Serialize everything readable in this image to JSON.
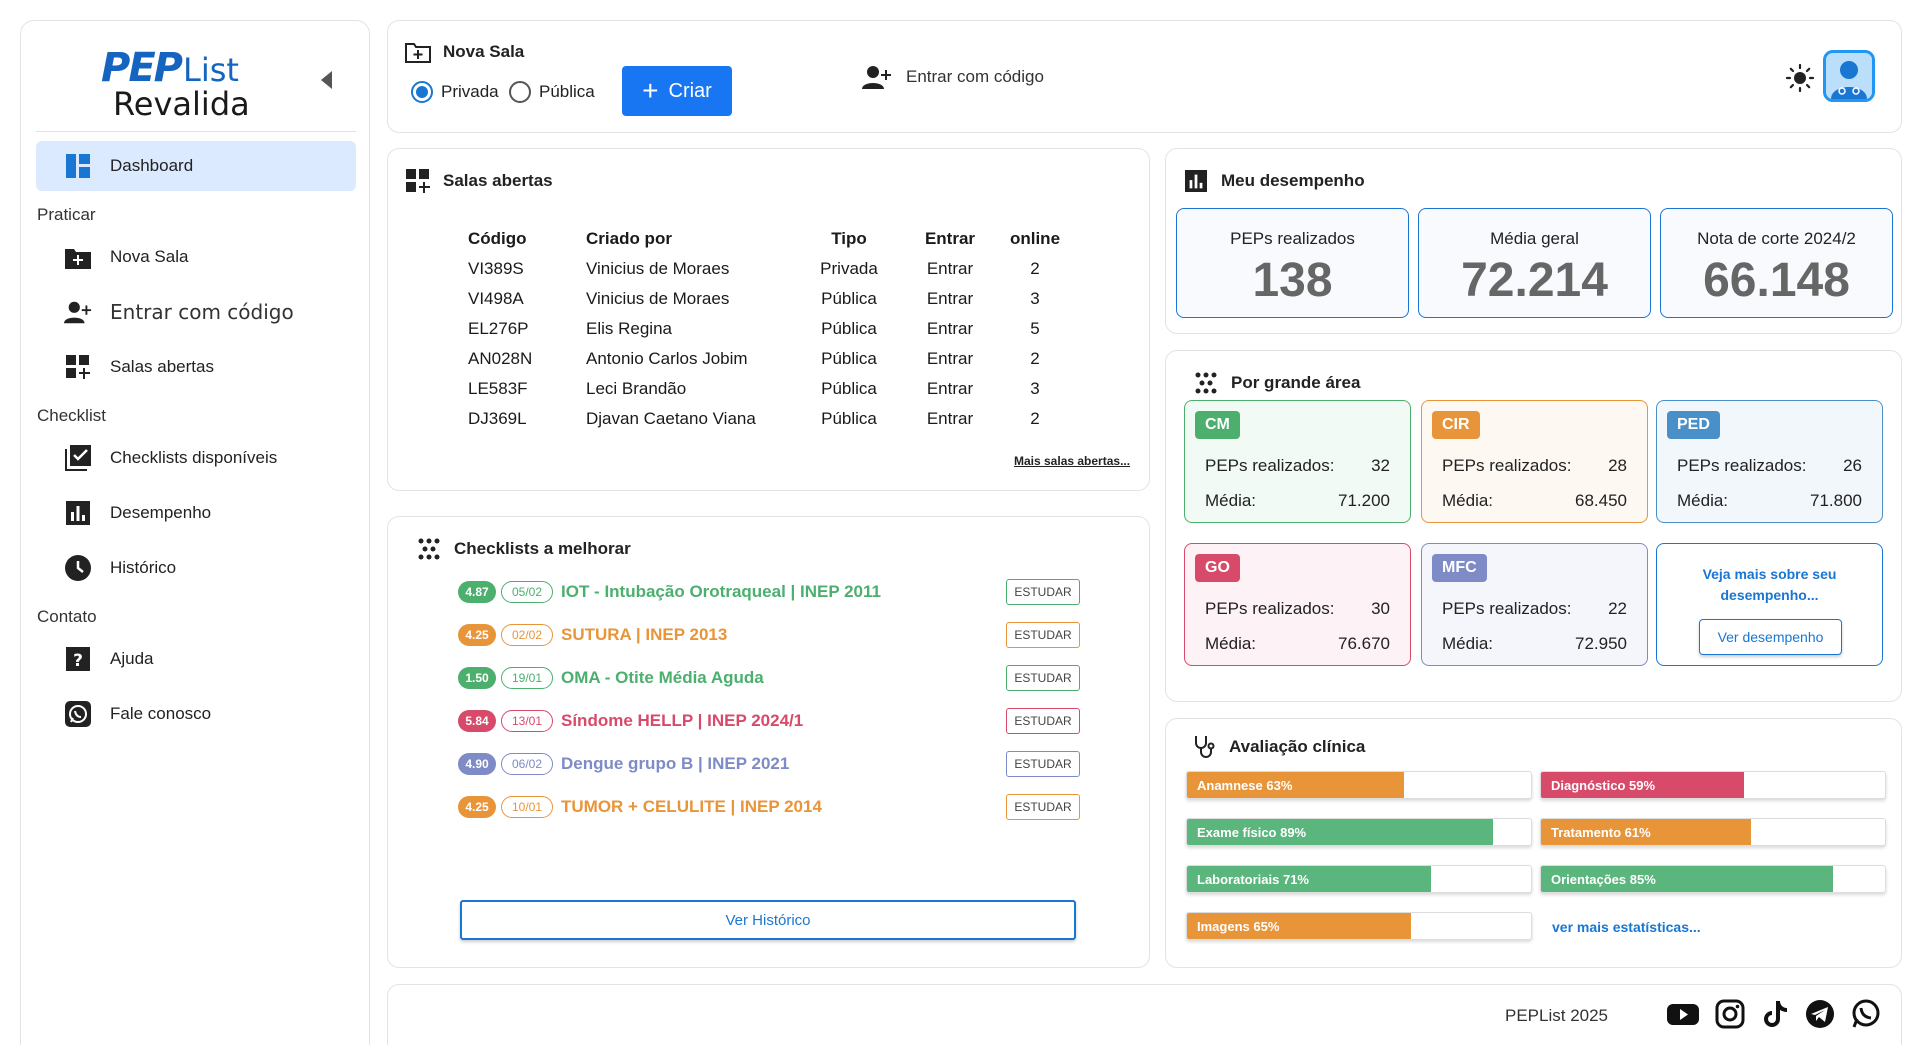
{
  "logo": {
    "brand_pep": "PEP",
    "brand_list": "List",
    "brand_sub": "Revalida"
  },
  "sidebar": {
    "dashboard": "Dashboard",
    "section_praticar": "Praticar",
    "nova_sala": "Nova Sala",
    "entrar_codigo": "Entrar com código",
    "salas_abertas": "Salas abertas",
    "section_checklist": "Checklist",
    "checklists_disponiveis": "Checklists disponíveis",
    "desempenho": "Desempenho",
    "historico": "Histórico",
    "section_contato": "Contato",
    "ajuda": "Ajuda",
    "fale_conosco": "Fale conosco"
  },
  "topbar": {
    "title": "Nova Sala",
    "privada": "Privada",
    "publica": "Pública",
    "criar": "Criar",
    "plus": "+",
    "entrar_codigo": "Entrar com código",
    "selected": "Privada"
  },
  "salas": {
    "title": "Salas abertas",
    "headers": [
      "Código",
      "Criado por",
      "Tipo",
      "Entrar",
      "online"
    ],
    "rows": [
      [
        "VI389S",
        "Vinicius de Moraes",
        "Privada",
        "Entrar",
        "2"
      ],
      [
        "VI498A",
        "Vinicius de Moraes",
        "Pública",
        "Entrar",
        "3"
      ],
      [
        "EL276P",
        "Elis Regina",
        "Pública",
        "Entrar",
        "5"
      ],
      [
        "AN028N",
        "Antonio Carlos Jobim",
        "Pública",
        "Entrar",
        "2"
      ],
      [
        "LE583F",
        "Leci Brandão",
        "Pública",
        "Entrar",
        "3"
      ],
      [
        "DJ369L",
        "Djavan Caetano Viana",
        "Pública",
        "Entrar",
        "2"
      ]
    ],
    "more": "Mais salas abertas..."
  },
  "checklists": {
    "title": "Checklists a melhorar",
    "items": [
      {
        "score": "4.87",
        "date": "05/02",
        "title": "IOT - Intubação Orotraqueal | INEP 2011",
        "color": "#4caf6e",
        "action": "ESTUDAR"
      },
      {
        "score": "4.25",
        "date": "02/02",
        "title": "SUTURA | INEP 2013",
        "color": "#e8953a",
        "action": "ESTUDAR"
      },
      {
        "score": "1.50",
        "date": "19/01",
        "title": "OMA - Otite Média Aguda",
        "color": "#4caf6e",
        "action": "ESTUDAR"
      },
      {
        "score": "5.84",
        "date": "13/01",
        "title": "Síndome HELLP | INEP 2024/1",
        "color": "#d84a6a",
        "action": "ESTUDAR"
      },
      {
        "score": "4.90",
        "date": "06/02",
        "title": "Dengue grupo B | INEP 2021",
        "color": "#7e8bc6",
        "action": "ESTUDAR"
      },
      {
        "score": "4.25",
        "date": "10/01",
        "title": "TUMOR + CELULITE | INEP 2014",
        "color": "#e8953a",
        "action": "ESTUDAR"
      }
    ],
    "ver_historico": "Ver Histórico"
  },
  "desempenho": {
    "title": "Meu desempenho",
    "stats": [
      {
        "label": "PEPs realizados",
        "value": "138"
      },
      {
        "label": "Média geral",
        "value": "72.214"
      },
      {
        "label": "Nota de corte 2024/2",
        "value": "66.148"
      }
    ]
  },
  "areas": {
    "title": "Por grande área",
    "peps_label": "PEPs realizados:",
    "media_label": "Média:",
    "items": [
      {
        "tag": "CM",
        "peps": "32",
        "media": "71.200",
        "color": "#4caf6e",
        "bg": "#f2faf5"
      },
      {
        "tag": "CIR",
        "peps": "28",
        "media": "68.450",
        "color": "#e8953a",
        "bg": "#fef8f2"
      },
      {
        "tag": "PED",
        "peps": "26",
        "media": "71.800",
        "color": "#4a90c8",
        "bg": "#f2f7fc"
      },
      {
        "tag": "GO",
        "peps": "30",
        "media": "76.670",
        "color": "#d84a6a",
        "bg": "#fdf2f5"
      },
      {
        "tag": "MFC",
        "peps": "22",
        "media": "72.950",
        "color": "#7e8bc6",
        "bg": "#f5f6fc"
      }
    ],
    "more_text": "Veja mais sobre seu desempenho...",
    "more_button": "Ver desempenho"
  },
  "avaliacao": {
    "title": "Avaliação clínica",
    "bars": [
      {
        "label": "Anamnese 63%",
        "value": 63,
        "color": "#e8953a"
      },
      {
        "label": "Diagnóstico 59%",
        "value": 59,
        "color": "#d84a6a"
      },
      {
        "label": "Exame físico 89%",
        "value": 89,
        "color": "#5bb67e"
      },
      {
        "label": "Tratamento 61%",
        "value": 61,
        "color": "#e8953a"
      },
      {
        "label": "Laboratoriais 71%",
        "value": 71,
        "color": "#5bb67e"
      },
      {
        "label": "Orientações 85%",
        "value": 85,
        "color": "#5bb67e"
      },
      {
        "label": "Imagens 65%",
        "value": 65,
        "color": "#e8953a"
      }
    ],
    "more": "ver mais estatísticas..."
  },
  "footer": {
    "text": "PEPList 2025",
    "icons": [
      "youtube-icon",
      "instagram-icon",
      "tiktok-icon",
      "telegram-icon",
      "whatsapp-icon"
    ]
  }
}
